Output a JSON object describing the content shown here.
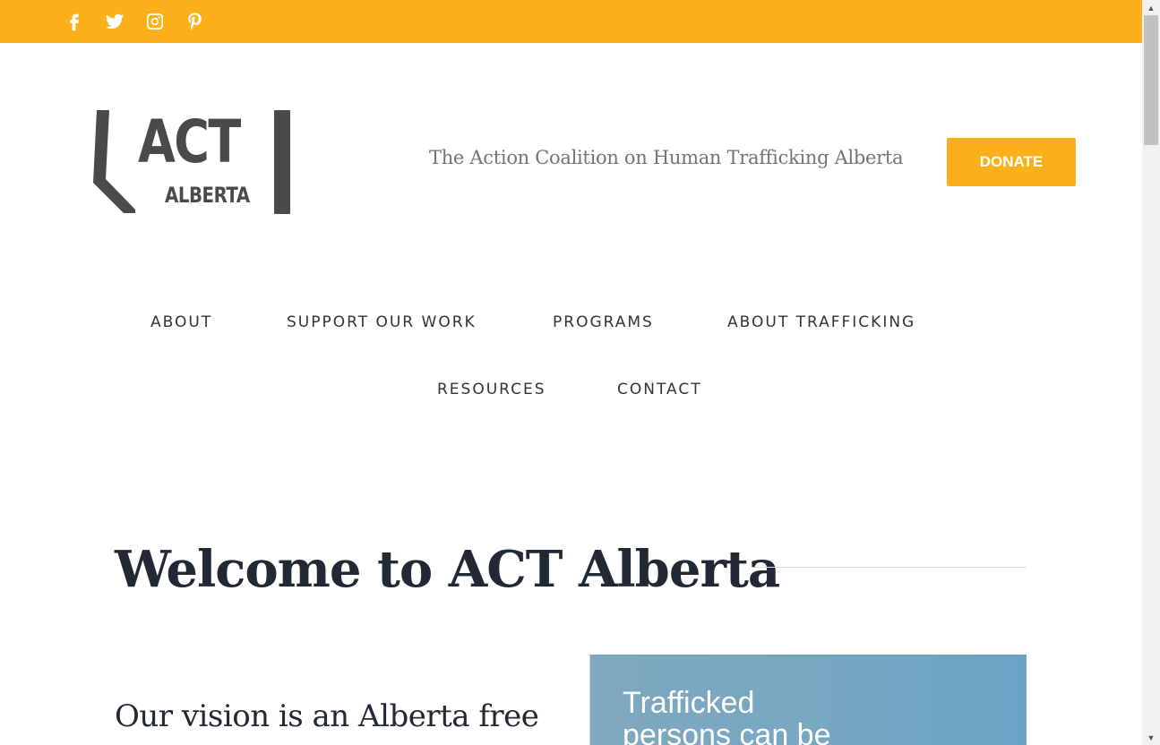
{
  "colors": {
    "accent": "#fbb01a",
    "logo": "#4a4a4c",
    "heading": "#212934",
    "tagline": "#747474"
  },
  "social": [
    {
      "icon": "facebook-icon"
    },
    {
      "icon": "twitter-icon"
    },
    {
      "icon": "instagram-icon"
    },
    {
      "icon": "pinterest-icon"
    }
  ],
  "logo": {
    "line1": "ACT",
    "line2": "ALBERTA"
  },
  "header": {
    "tagline": "The Action Coalition on Human Trafficking Alberta",
    "donate_label": "DONATE"
  },
  "nav": {
    "items": [
      "ABOUT",
      "SUPPORT OUR WORK",
      "PROGRAMS",
      "ABOUT TRAFFICKING",
      "RESOURCES",
      "CONTACT"
    ]
  },
  "main": {
    "title": "Welcome to ACT Alberta",
    "vision_text": "Our vision is an Alberta free",
    "image_text_line1": "Trafficked",
    "image_text_line2": "persons can be"
  }
}
